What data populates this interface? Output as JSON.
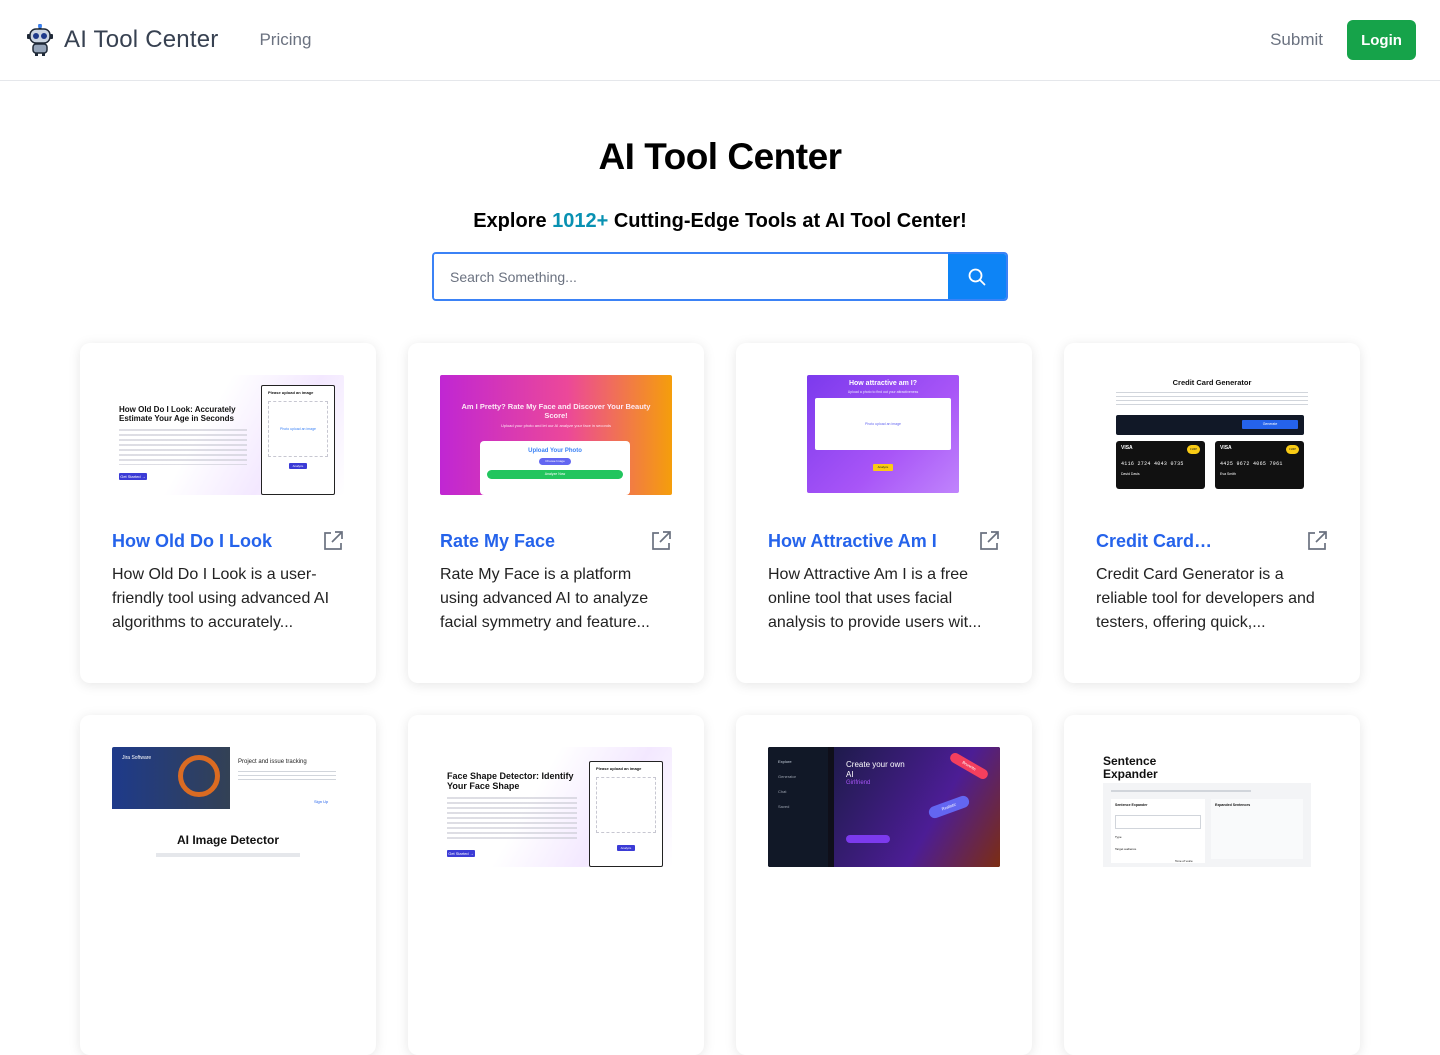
{
  "header": {
    "brand": "AI Tool Center",
    "nav_pricing": "Pricing",
    "nav_submit": "Submit",
    "login": "Login"
  },
  "hero": {
    "title": "AI Tool Center",
    "sub_prefix": "Explore ",
    "count": "1012+",
    "sub_suffix": " Cutting-Edge Tools at AI Tool Center!"
  },
  "search": {
    "placeholder": "Search Something..."
  },
  "colors": {
    "accent_blue": "#2563eb",
    "login_green": "#16a34a",
    "count_teal": "#0891b2",
    "search_button": "#0d84f6"
  },
  "tools": [
    {
      "title": "How Old Do I Look",
      "desc": "How Old Do I Look is a user-friendly tool using advanced AI algorithms to accurately...",
      "thumb": {
        "heading": "How Old Do I Look: Accurately Estimate Your Age in Seconds",
        "panel": "Please upload an image",
        "link": "Photo upload an image",
        "btn": "Get Started →",
        "btn2": "Analyze"
      }
    },
    {
      "title": "Rate My Face",
      "desc": "Rate My Face is a platform using advanced AI to analyze facial symmetry and feature...",
      "thumb": {
        "heading": "Am I Pretty? Rate My Face and Discover Your Beauty Score!",
        "line": "Upload your photo and let our AI analyze your face in seconds",
        "panel": "Upload Your Photo",
        "btn": "Choose Image",
        "btn2": "Analyze Now"
      }
    },
    {
      "title": "How Attractive Am I",
      "desc": "How Attractive Am I is a free online tool that uses facial analysis to provide users wit...",
      "thumb": {
        "heading": "How attractive am I?",
        "line": "Upload a photo to find out your attractiveness",
        "link": "Photo upload an image",
        "btn": "Analyze"
      }
    },
    {
      "title": "Credit Card Generator",
      "desc": "Credit Card Generator is a reliable tool for developers and testers, offering quick,...",
      "thumb": {
        "heading": "Credit Card Generator",
        "btn": "Generate",
        "card_brand_a": "VISA",
        "card_brand_b": "VISA",
        "chip": "CHIP",
        "num_a": "4116 2724 4043 0735",
        "num_b": "4425 9672 4065 7961",
        "name_a": "David Davis",
        "name_b": "Eva Smith"
      }
    },
    {
      "title": "AI Image Detector",
      "desc": "",
      "thumb": {
        "brand": "Jira Software",
        "ad": "Project and issue tracking",
        "ad_cta": "Sign Up",
        "heading": "AI Image Detector"
      }
    },
    {
      "title": "Face Shape Detector",
      "desc": "",
      "thumb": {
        "heading": "Face Shape Detector: Identify Your Face Shape",
        "panel": "Please upload an image",
        "btn": "Get Started →",
        "btn2": "Analyze"
      }
    },
    {
      "title": "AI Girlfriend",
      "desc": "",
      "thumb": {
        "heading": "Create your own AI",
        "accent": "Girlfriend",
        "menu": [
          "Explore",
          "Generator",
          "Chat",
          "Saved"
        ],
        "tag_a": "Brunette",
        "tag_b": "Realistic"
      }
    },
    {
      "title": "Sentence Expander",
      "desc": "",
      "thumb": {
        "heading": "Sentence Expander",
        "col_a": "Sentence Expander",
        "col_b": "Expanded Sentences",
        "type": "Type",
        "aud": "Target audience",
        "tone": "Tone of voice"
      }
    }
  ]
}
